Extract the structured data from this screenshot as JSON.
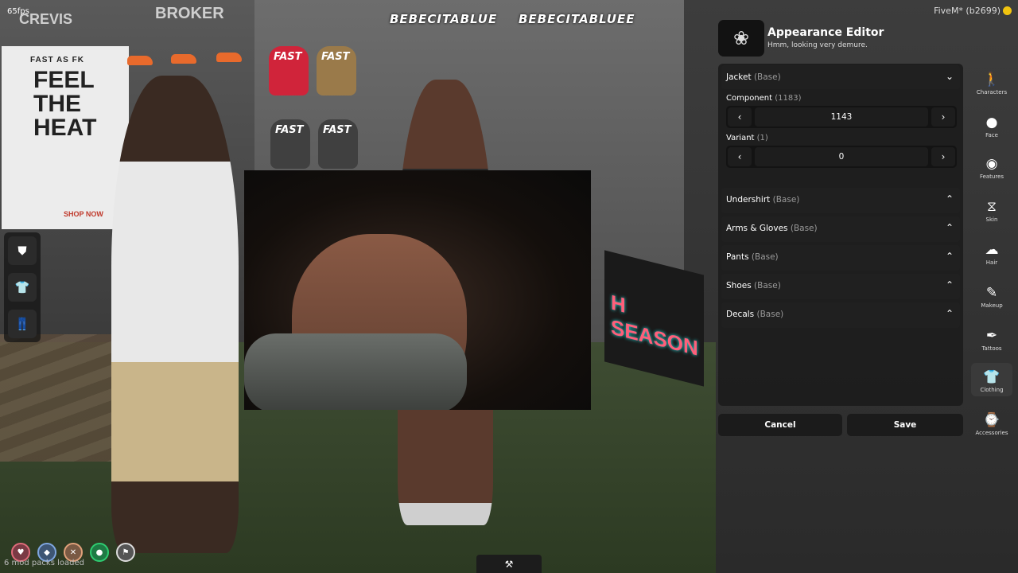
{
  "hud": {
    "fps": "65fps",
    "client": "FiveM* (b2699)",
    "mods_loaded": "6 mod packs loaded",
    "social_left": "BEBECITABLUE",
    "social_right": "BEBECITABLUEE",
    "status_icons": [
      "heart-icon",
      "shield-icon",
      "hunger-icon",
      "thirst-icon",
      "stamina-icon"
    ],
    "status_colors": [
      "#e06b7a",
      "#7fa6e0",
      "#e0a07a",
      "#2ecc71",
      "#dddddd"
    ]
  },
  "scene_text": {
    "brand_left": "CREVIS",
    "brand_mid": "BROKER",
    "poster_top": "FAST AS FK",
    "poster_main": "FEEL THE HEAT",
    "poster_cta": "SHOP NOW",
    "bag_label": "FAST",
    "sign": "H SEASON"
  },
  "left_dock": {
    "items": [
      {
        "icon": "mask-icon"
      },
      {
        "icon": "shirt-icon"
      },
      {
        "icon": "pants-icon"
      }
    ]
  },
  "editor": {
    "title": "Appearance Editor",
    "subtitle": "Hmm, looking very demure.",
    "jacket": {
      "label": "Jacket",
      "tag": "(Base)"
    },
    "component": {
      "label": "Component",
      "count": "(1183)",
      "value": "1143"
    },
    "variant": {
      "label": "Variant",
      "count": "(1)",
      "value": "0"
    },
    "sections": [
      {
        "label": "Undershirt",
        "tag": "(Base)"
      },
      {
        "label": "Arms & Gloves",
        "tag": "(Base)"
      },
      {
        "label": "Pants",
        "tag": "(Base)"
      },
      {
        "label": "Shoes",
        "tag": "(Base)"
      },
      {
        "label": "Decals",
        "tag": "(Base)"
      }
    ],
    "cancel_label": "Cancel",
    "save_label": "Save"
  },
  "categories": [
    {
      "label": "Characters",
      "icon": "person-icon"
    },
    {
      "label": "Face",
      "icon": "face-icon"
    },
    {
      "label": "Features",
      "icon": "features-icon"
    },
    {
      "label": "Skin",
      "icon": "dna-icon"
    },
    {
      "label": "Hair",
      "icon": "hair-icon"
    },
    {
      "label": "Makeup",
      "icon": "brush-icon"
    },
    {
      "label": "Tattoos",
      "icon": "tattoo-icon"
    },
    {
      "label": "Clothing",
      "icon": "shirt-icon",
      "active": true
    },
    {
      "label": "Accessories",
      "icon": "watch-icon"
    }
  ]
}
